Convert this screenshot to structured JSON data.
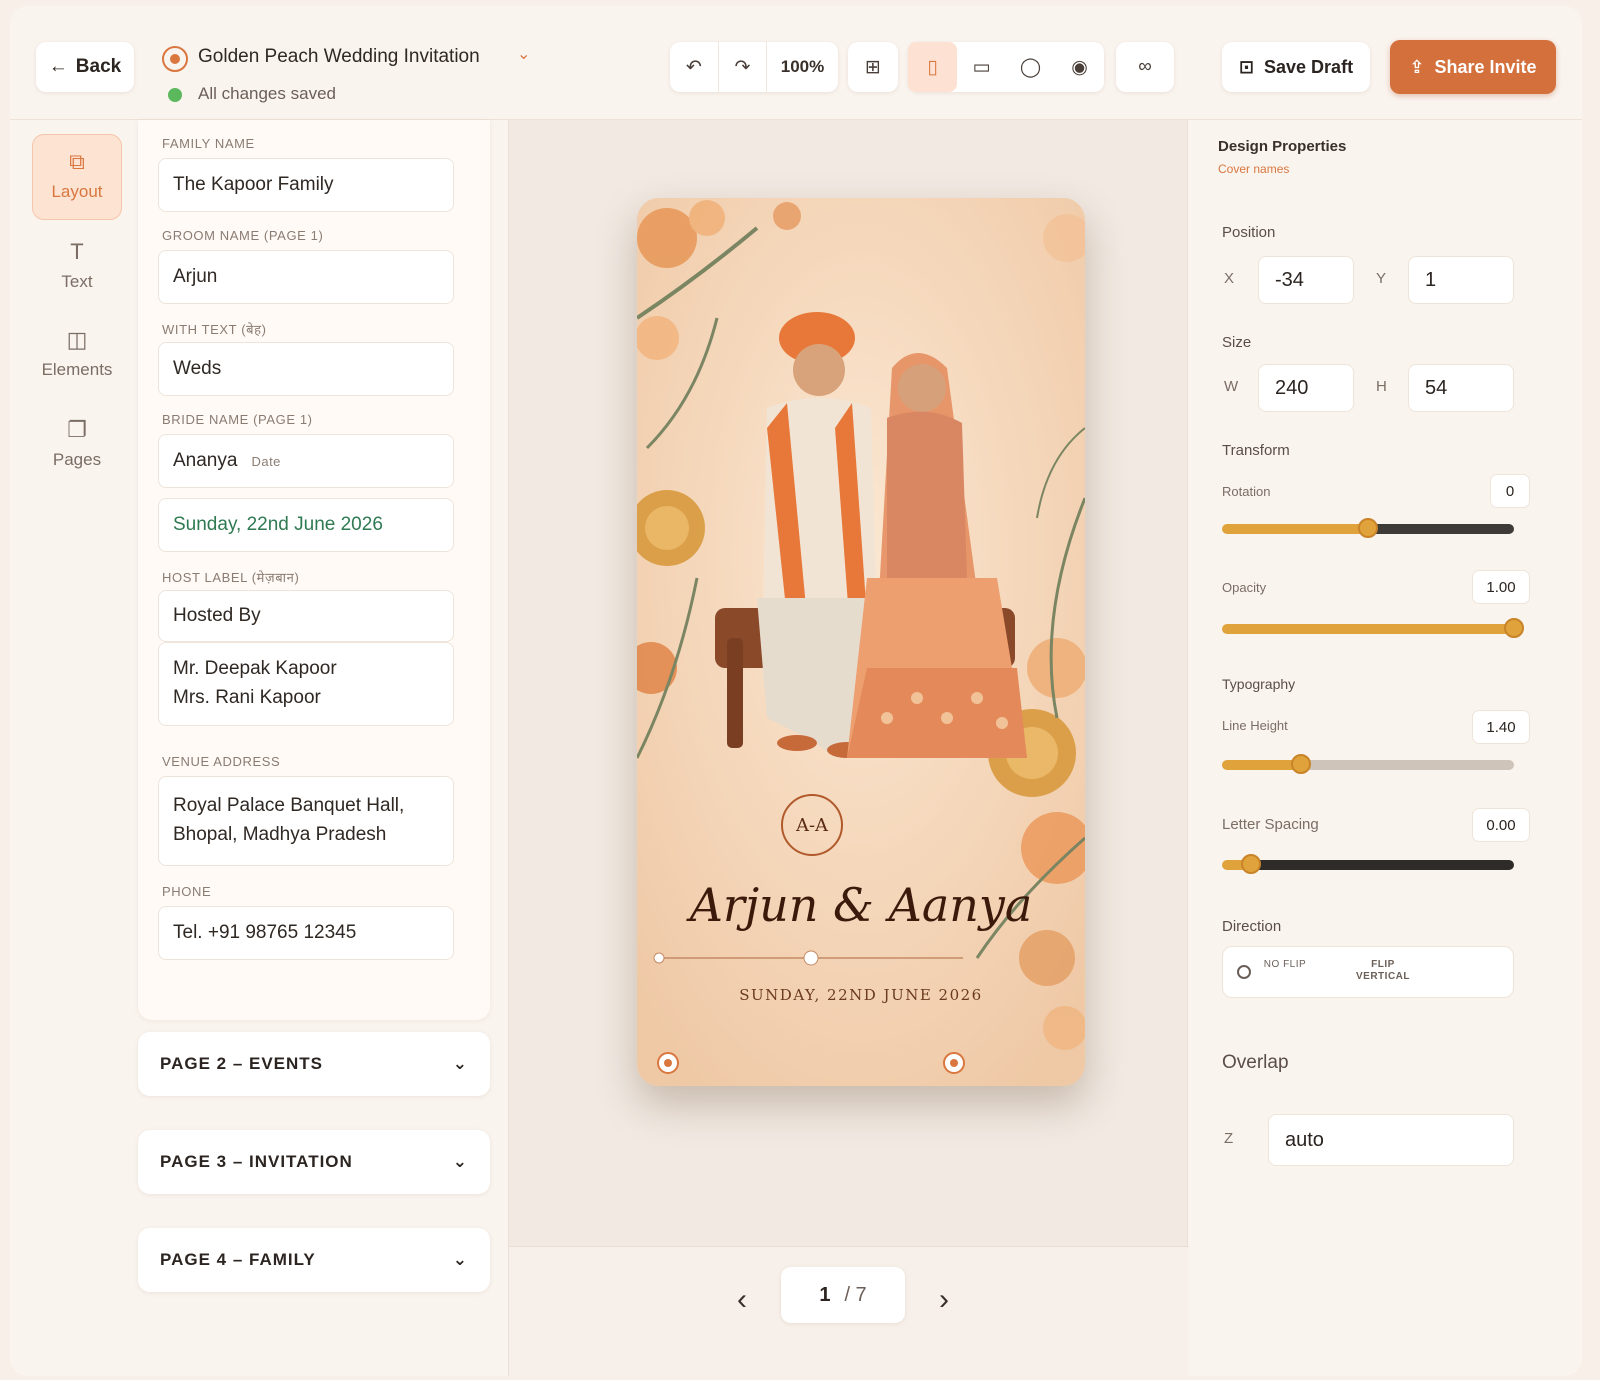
{
  "header": {
    "back_label": "Back",
    "doc_title": "Golden Peach Wedding Invitation",
    "status": "All changes saved",
    "zoom": "100%",
    "save_label": "Save Draft",
    "share_label": "Share Invite"
  },
  "rail": [
    {
      "label": "Layout",
      "icon": "layout-icon"
    },
    {
      "label": "Text",
      "icon": "text-icon"
    },
    {
      "label": "Elements",
      "icon": "elements-icon"
    },
    {
      "label": "Pages",
      "icon": "pages-icon"
    }
  ],
  "form": {
    "family_label": "Family Name",
    "family_value": "The Kapoor Family",
    "groom_label": "Groom Name (Page 1)",
    "groom_value": "Arjun",
    "with_label": "With Text (बेह)",
    "with_value": "Weds",
    "bride_label": "Bride Name (Page 1)",
    "bride_value": "Ananya",
    "date_label": "Date",
    "date_value": "Sunday, 22nd June 2026",
    "host_label": "Host Label (मेज़बान)",
    "host_value": "Hosted By",
    "host_name_1": "Mr. Deepak Kapoor",
    "host_name_2": "Mrs. Rani Kapoor",
    "venue_label": "Venue Address",
    "venue_line_1": "Royal Palace Banquet Hall,",
    "venue_line_2": "Bhopal, Madhya Pradesh",
    "phone_label": "Phone",
    "phone_value": "Tel. +91 98765 12345"
  },
  "accordions": [
    {
      "label": "PAGE 2 – EVENTS"
    },
    {
      "label": "PAGE 3 – INVITATION"
    },
    {
      "label": "PAGE 4 – FAMILY"
    }
  ],
  "card": {
    "monogram": "A-A",
    "names": "Arjun & Aanya",
    "date": "SUNDAY, 22ND JUNE 2026"
  },
  "pager": {
    "current": "1",
    "total": "/ 7"
  },
  "properties": {
    "title": "Design Properties",
    "subtitle": "Cover names",
    "position_label": "Position",
    "x_label": "X",
    "x_value": "-34",
    "y_label": "Y",
    "y_value": "1",
    "size_label": "Size",
    "w_label": "W",
    "w_value": "240",
    "h_label": "H",
    "h_value": "54",
    "transform_label": "Transform",
    "rotation_label": "Rotation",
    "rotation_value": "0",
    "rotation_fraction": 0.5,
    "opacity_label": "Opacity",
    "opacity_value": "1.00",
    "opacity_fraction": 1.0,
    "typography_label": "Typography",
    "line_height_label": "Line Height",
    "line_height_value": "1.40",
    "line_height_fraction": 0.27,
    "letter_spacing_label": "Letter Spacing",
    "letter_spacing_value": "0.00",
    "letter_spacing_fraction": 0.1,
    "direction_label": "Direction",
    "direction_opt_1": "No Flip",
    "direction_opt_2": "Flip Vertical",
    "overlap_label": "Overlap",
    "z_label": "Z",
    "z_value": "auto"
  },
  "colors": {
    "accent": "#d4703c",
    "saved": "#5cb85c",
    "slider": "#e0a23a"
  }
}
